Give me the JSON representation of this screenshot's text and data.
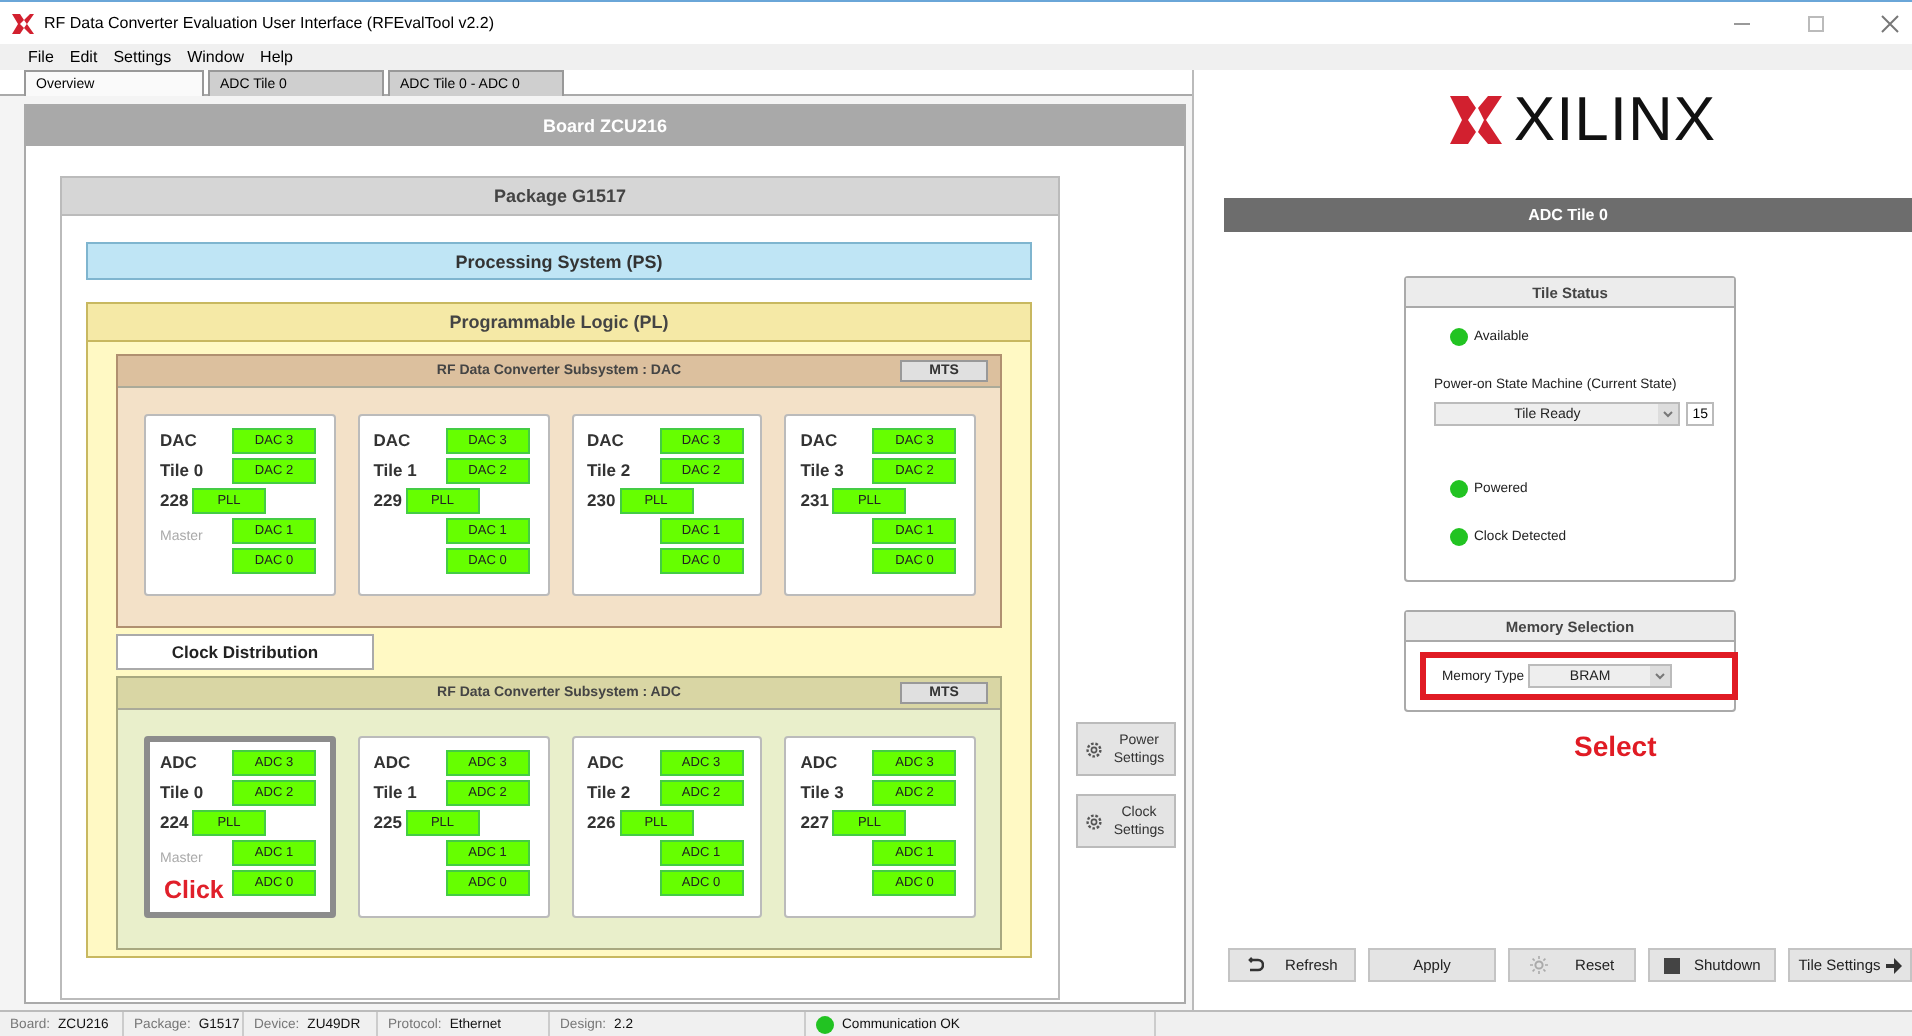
{
  "window": {
    "title": "RF Data Converter Evaluation User Interface (RFEvalTool v2.2)"
  },
  "menu": [
    "File",
    "Edit",
    "Settings",
    "Window",
    "Help"
  ],
  "tabs": [
    {
      "label": "Overview",
      "selected": true
    },
    {
      "label": "ADC Tile 0",
      "selected": false
    },
    {
      "label": "ADC Tile 0 - ADC 0",
      "selected": false
    }
  ],
  "board": {
    "title": "Board ZCU216"
  },
  "package": {
    "title": "Package G1517"
  },
  "processing_system": "Processing System (PS)",
  "programmable_logic": {
    "title": "Programmable Logic (PL)"
  },
  "subsystems": [
    {
      "kind": "dac",
      "title": "RF Data Converter Subsystem : DAC",
      "mts": "MTS",
      "tiles": [
        {
          "type": "DAC",
          "tile": "Tile 0",
          "number": "228",
          "master": "Master",
          "selected": false,
          "pll": "PLL",
          "converters": [
            "DAC 3",
            "DAC 2",
            "DAC 1",
            "DAC 0"
          ]
        },
        {
          "type": "DAC",
          "tile": "Tile 1",
          "number": "229",
          "selected": false,
          "pll": "PLL",
          "converters": [
            "DAC 3",
            "DAC 2",
            "DAC 1",
            "DAC 0"
          ]
        },
        {
          "type": "DAC",
          "tile": "Tile 2",
          "number": "230",
          "selected": false,
          "pll": "PLL",
          "converters": [
            "DAC 3",
            "DAC 2",
            "DAC 1",
            "DAC 0"
          ]
        },
        {
          "type": "DAC",
          "tile": "Tile 3",
          "number": "231",
          "selected": false,
          "pll": "PLL",
          "converters": [
            "DAC 3",
            "DAC 2",
            "DAC 1",
            "DAC 0"
          ]
        }
      ]
    },
    {
      "kind": "adc",
      "title": "RF Data Converter Subsystem : ADC",
      "mts": "MTS",
      "tiles": [
        {
          "type": "ADC",
          "tile": "Tile 0",
          "number": "224",
          "master": "Master",
          "selected": true,
          "annotation": "Click",
          "pll": "PLL",
          "converters": [
            "ADC 3",
            "ADC 2",
            "ADC 1",
            "ADC 0"
          ]
        },
        {
          "type": "ADC",
          "tile": "Tile 1",
          "number": "225",
          "selected": false,
          "pll": "PLL",
          "converters": [
            "ADC 3",
            "ADC 2",
            "ADC 1",
            "ADC 0"
          ]
        },
        {
          "type": "ADC",
          "tile": "Tile 2",
          "number": "226",
          "selected": false,
          "pll": "PLL",
          "converters": [
            "ADC 3",
            "ADC 2",
            "ADC 1",
            "ADC 0"
          ]
        },
        {
          "type": "ADC",
          "tile": "Tile 3",
          "number": "227",
          "selected": false,
          "pll": "PLL",
          "converters": [
            "ADC 3",
            "ADC 2",
            "ADC 1",
            "ADC 0"
          ]
        }
      ]
    }
  ],
  "clock_distribution": "Clock Distribution",
  "side_buttons": [
    {
      "label": "Power Settings"
    },
    {
      "label": "Clock Settings"
    }
  ],
  "logo": "XILINX",
  "detail_header": "ADC Tile 0",
  "tile_status": {
    "title": "Tile Status",
    "indicators": [
      {
        "label": "Available",
        "color": "#22c322"
      }
    ],
    "state_label": "Power-on State Machine (Current State)",
    "state_value": "Tile Ready",
    "state_code": "15",
    "more_indicators": [
      {
        "label": "Powered",
        "color": "#22c322"
      },
      {
        "label": "Clock Detected",
        "color": "#22c322"
      }
    ]
  },
  "memory_selection": {
    "title": "Memory Selection",
    "label": "Memory Type",
    "value": "BRAM",
    "annotation": "Select"
  },
  "actions": [
    {
      "kind": "refresh",
      "label": "Refresh"
    },
    {
      "kind": "plain",
      "label": "Apply"
    },
    {
      "kind": "reset",
      "label": "Reset"
    },
    {
      "kind": "shutdown",
      "label": "Shutdown"
    },
    {
      "kind": "next",
      "label": "Tile Settings"
    }
  ],
  "status_bar": {
    "fields": [
      {
        "label": "Board:",
        "value": "ZCU216"
      },
      {
        "label": "Package:",
        "value": "G1517"
      },
      {
        "label": "Device:",
        "value": "ZU49DR"
      },
      {
        "label": "Protocol:",
        "value": "Ethernet"
      },
      {
        "label": "Design:",
        "value": "2.2"
      }
    ],
    "connection": {
      "label": "Communication OK",
      "color": "#22c322"
    }
  }
}
